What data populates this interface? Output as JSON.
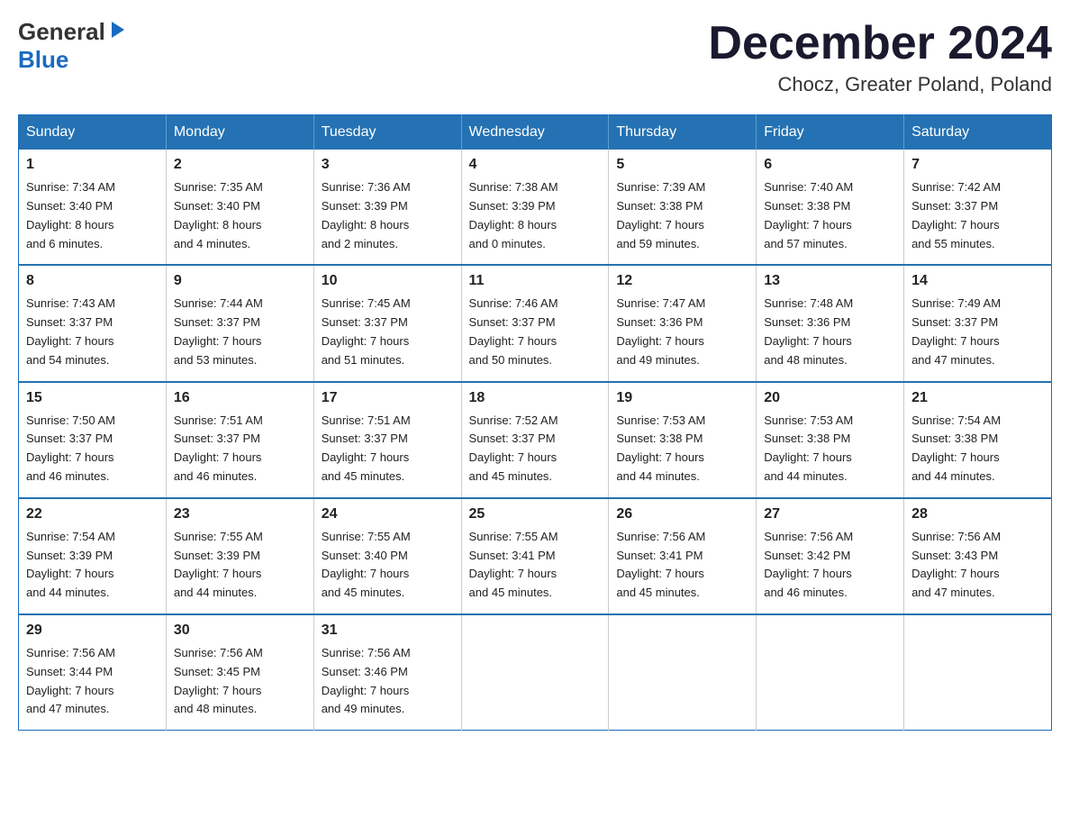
{
  "header": {
    "logo": {
      "general": "General",
      "arrow": "▶",
      "blue": "Blue"
    },
    "title": "December 2024",
    "location": "Chocz, Greater Poland, Poland"
  },
  "calendar": {
    "days_of_week": [
      "Sunday",
      "Monday",
      "Tuesday",
      "Wednesday",
      "Thursday",
      "Friday",
      "Saturday"
    ],
    "weeks": [
      [
        {
          "day": "1",
          "sunrise": "Sunrise: 7:34 AM",
          "sunset": "Sunset: 3:40 PM",
          "daylight": "Daylight: 8 hours",
          "daylight2": "and 6 minutes."
        },
        {
          "day": "2",
          "sunrise": "Sunrise: 7:35 AM",
          "sunset": "Sunset: 3:40 PM",
          "daylight": "Daylight: 8 hours",
          "daylight2": "and 4 minutes."
        },
        {
          "day": "3",
          "sunrise": "Sunrise: 7:36 AM",
          "sunset": "Sunset: 3:39 PM",
          "daylight": "Daylight: 8 hours",
          "daylight2": "and 2 minutes."
        },
        {
          "day": "4",
          "sunrise": "Sunrise: 7:38 AM",
          "sunset": "Sunset: 3:39 PM",
          "daylight": "Daylight: 8 hours",
          "daylight2": "and 0 minutes."
        },
        {
          "day": "5",
          "sunrise": "Sunrise: 7:39 AM",
          "sunset": "Sunset: 3:38 PM",
          "daylight": "Daylight: 7 hours",
          "daylight2": "and 59 minutes."
        },
        {
          "day": "6",
          "sunrise": "Sunrise: 7:40 AM",
          "sunset": "Sunset: 3:38 PM",
          "daylight": "Daylight: 7 hours",
          "daylight2": "and 57 minutes."
        },
        {
          "day": "7",
          "sunrise": "Sunrise: 7:42 AM",
          "sunset": "Sunset: 3:37 PM",
          "daylight": "Daylight: 7 hours",
          "daylight2": "and 55 minutes."
        }
      ],
      [
        {
          "day": "8",
          "sunrise": "Sunrise: 7:43 AM",
          "sunset": "Sunset: 3:37 PM",
          "daylight": "Daylight: 7 hours",
          "daylight2": "and 54 minutes."
        },
        {
          "day": "9",
          "sunrise": "Sunrise: 7:44 AM",
          "sunset": "Sunset: 3:37 PM",
          "daylight": "Daylight: 7 hours",
          "daylight2": "and 53 minutes."
        },
        {
          "day": "10",
          "sunrise": "Sunrise: 7:45 AM",
          "sunset": "Sunset: 3:37 PM",
          "daylight": "Daylight: 7 hours",
          "daylight2": "and 51 minutes."
        },
        {
          "day": "11",
          "sunrise": "Sunrise: 7:46 AM",
          "sunset": "Sunset: 3:37 PM",
          "daylight": "Daylight: 7 hours",
          "daylight2": "and 50 minutes."
        },
        {
          "day": "12",
          "sunrise": "Sunrise: 7:47 AM",
          "sunset": "Sunset: 3:36 PM",
          "daylight": "Daylight: 7 hours",
          "daylight2": "and 49 minutes."
        },
        {
          "day": "13",
          "sunrise": "Sunrise: 7:48 AM",
          "sunset": "Sunset: 3:36 PM",
          "daylight": "Daylight: 7 hours",
          "daylight2": "and 48 minutes."
        },
        {
          "day": "14",
          "sunrise": "Sunrise: 7:49 AM",
          "sunset": "Sunset: 3:37 PM",
          "daylight": "Daylight: 7 hours",
          "daylight2": "and 47 minutes."
        }
      ],
      [
        {
          "day": "15",
          "sunrise": "Sunrise: 7:50 AM",
          "sunset": "Sunset: 3:37 PM",
          "daylight": "Daylight: 7 hours",
          "daylight2": "and 46 minutes."
        },
        {
          "day": "16",
          "sunrise": "Sunrise: 7:51 AM",
          "sunset": "Sunset: 3:37 PM",
          "daylight": "Daylight: 7 hours",
          "daylight2": "and 46 minutes."
        },
        {
          "day": "17",
          "sunrise": "Sunrise: 7:51 AM",
          "sunset": "Sunset: 3:37 PM",
          "daylight": "Daylight: 7 hours",
          "daylight2": "and 45 minutes."
        },
        {
          "day": "18",
          "sunrise": "Sunrise: 7:52 AM",
          "sunset": "Sunset: 3:37 PM",
          "daylight": "Daylight: 7 hours",
          "daylight2": "and 45 minutes."
        },
        {
          "day": "19",
          "sunrise": "Sunrise: 7:53 AM",
          "sunset": "Sunset: 3:38 PM",
          "daylight": "Daylight: 7 hours",
          "daylight2": "and 44 minutes."
        },
        {
          "day": "20",
          "sunrise": "Sunrise: 7:53 AM",
          "sunset": "Sunset: 3:38 PM",
          "daylight": "Daylight: 7 hours",
          "daylight2": "and 44 minutes."
        },
        {
          "day": "21",
          "sunrise": "Sunrise: 7:54 AM",
          "sunset": "Sunset: 3:38 PM",
          "daylight": "Daylight: 7 hours",
          "daylight2": "and 44 minutes."
        }
      ],
      [
        {
          "day": "22",
          "sunrise": "Sunrise: 7:54 AM",
          "sunset": "Sunset: 3:39 PM",
          "daylight": "Daylight: 7 hours",
          "daylight2": "and 44 minutes."
        },
        {
          "day": "23",
          "sunrise": "Sunrise: 7:55 AM",
          "sunset": "Sunset: 3:39 PM",
          "daylight": "Daylight: 7 hours",
          "daylight2": "and 44 minutes."
        },
        {
          "day": "24",
          "sunrise": "Sunrise: 7:55 AM",
          "sunset": "Sunset: 3:40 PM",
          "daylight": "Daylight: 7 hours",
          "daylight2": "and 45 minutes."
        },
        {
          "day": "25",
          "sunrise": "Sunrise: 7:55 AM",
          "sunset": "Sunset: 3:41 PM",
          "daylight": "Daylight: 7 hours",
          "daylight2": "and 45 minutes."
        },
        {
          "day": "26",
          "sunrise": "Sunrise: 7:56 AM",
          "sunset": "Sunset: 3:41 PM",
          "daylight": "Daylight: 7 hours",
          "daylight2": "and 45 minutes."
        },
        {
          "day": "27",
          "sunrise": "Sunrise: 7:56 AM",
          "sunset": "Sunset: 3:42 PM",
          "daylight": "Daylight: 7 hours",
          "daylight2": "and 46 minutes."
        },
        {
          "day": "28",
          "sunrise": "Sunrise: 7:56 AM",
          "sunset": "Sunset: 3:43 PM",
          "daylight": "Daylight: 7 hours",
          "daylight2": "and 47 minutes."
        }
      ],
      [
        {
          "day": "29",
          "sunrise": "Sunrise: 7:56 AM",
          "sunset": "Sunset: 3:44 PM",
          "daylight": "Daylight: 7 hours",
          "daylight2": "and 47 minutes."
        },
        {
          "day": "30",
          "sunrise": "Sunrise: 7:56 AM",
          "sunset": "Sunset: 3:45 PM",
          "daylight": "Daylight: 7 hours",
          "daylight2": "and 48 minutes."
        },
        {
          "day": "31",
          "sunrise": "Sunrise: 7:56 AM",
          "sunset": "Sunset: 3:46 PM",
          "daylight": "Daylight: 7 hours",
          "daylight2": "and 49 minutes."
        },
        null,
        null,
        null,
        null
      ]
    ]
  }
}
